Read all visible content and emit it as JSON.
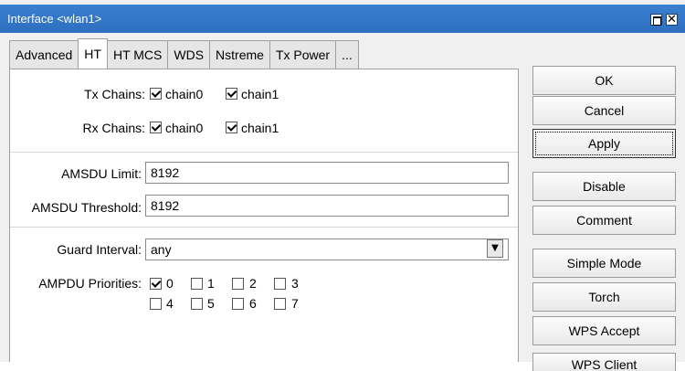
{
  "window": {
    "title": "Interface <wlan1>",
    "close_glyph": "✕"
  },
  "tabs": [
    {
      "label": "Advanced"
    },
    {
      "label": "HT"
    },
    {
      "label": "HT MCS"
    },
    {
      "label": "WDS"
    },
    {
      "label": "Nstreme"
    },
    {
      "label": "Tx Power"
    },
    {
      "label": "..."
    }
  ],
  "ht": {
    "tx_chains_label": "Tx Chains:",
    "tx_chain0": {
      "label": "chain0",
      "checked": true
    },
    "tx_chain1": {
      "label": "chain1",
      "checked": true
    },
    "rx_chains_label": "Rx Chains:",
    "rx_chain0": {
      "label": "chain0",
      "checked": true
    },
    "rx_chain1": {
      "label": "chain1",
      "checked": true
    },
    "amsdu_limit_label": "AMSDU Limit:",
    "amsdu_limit_value": "8192",
    "amsdu_threshold_label": "AMSDU Threshold:",
    "amsdu_threshold_value": "8192",
    "guard_interval_label": "Guard Interval:",
    "guard_interval_value": "any",
    "ampdu_label": "AMPDU Priorities:",
    "ampdu": [
      {
        "label": "0",
        "checked": true
      },
      {
        "label": "1",
        "checked": false
      },
      {
        "label": "2",
        "checked": false
      },
      {
        "label": "3",
        "checked": false
      },
      {
        "label": "4",
        "checked": false
      },
      {
        "label": "5",
        "checked": false
      },
      {
        "label": "6",
        "checked": false
      },
      {
        "label": "7",
        "checked": false
      }
    ]
  },
  "buttons": {
    "ok": "OK",
    "cancel": "Cancel",
    "apply": "Apply",
    "disable": "Disable",
    "comment": "Comment",
    "simple_mode": "Simple Mode",
    "torch": "Torch",
    "wps_accept": "WPS Accept",
    "wps_client": "WPS Client"
  }
}
